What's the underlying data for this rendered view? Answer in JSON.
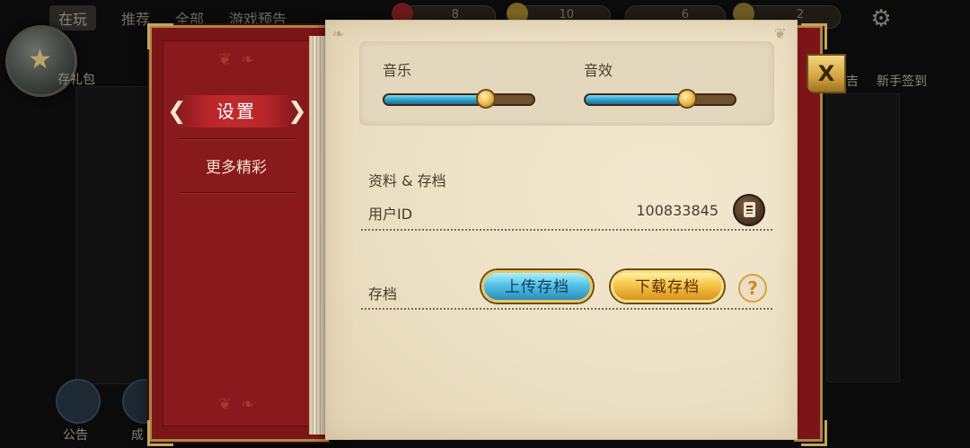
{
  "background": {
    "tabs": [
      "在玩",
      "推荐",
      "全部",
      "游戏预告"
    ],
    "resources": [
      "8",
      "10",
      "6",
      "2"
    ],
    "labels": {
      "gift": "存礼包",
      "checkin": "新手签到",
      "partial_right": "吉",
      "notice": "公告",
      "partial_bottom": "成"
    }
  },
  "sidebar": {
    "active_item": "设置",
    "items": [
      "更多精彩"
    ]
  },
  "audio": {
    "music_label": "音乐",
    "music_level": 0.68,
    "sfx_label": "音效",
    "sfx_level": 0.68
  },
  "account": {
    "section_title": "资料 & 存档",
    "user_id_label": "用户ID",
    "user_id_value": "100833845"
  },
  "save": {
    "label": "存档",
    "upload_label": "上传存档",
    "download_label": "下载存档",
    "help_symbol": "?"
  },
  "close_symbol": "X"
}
